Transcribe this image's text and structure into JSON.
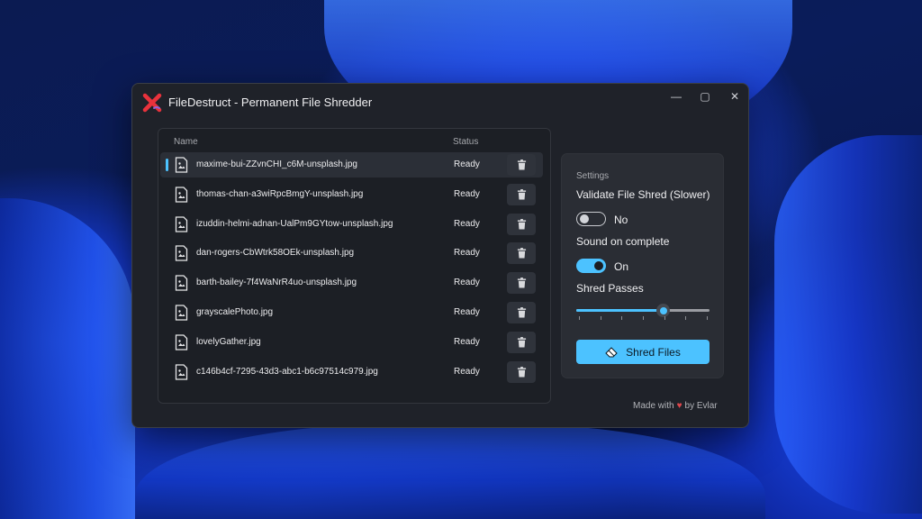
{
  "window": {
    "title": "FileDestruct - Permanent File Shredder",
    "controls": {
      "minimize": "—",
      "maximize": "▢",
      "close": "✕"
    }
  },
  "file_list": {
    "columns": {
      "name": "Name",
      "status": "Status"
    },
    "files": [
      {
        "name": "maxime-bui-ZZvnCHI_c6M-unsplash.jpg",
        "status": "Ready",
        "selected": true
      },
      {
        "name": "thomas-chan-a3wiRpcBmgY-unsplash.jpg",
        "status": "Ready"
      },
      {
        "name": "izuddin-helmi-adnan-UalPm9GYtow-unsplash.jpg",
        "status": "Ready"
      },
      {
        "name": "dan-rogers-CbWtrk58OEk-unsplash.jpg",
        "status": "Ready"
      },
      {
        "name": "barth-bailey-7f4WaNrR4uo-unsplash.jpg",
        "status": "Ready"
      },
      {
        "name": "grayscalePhoto.jpg",
        "status": "Ready"
      },
      {
        "name": "lovelyGather.jpg",
        "status": "Ready"
      },
      {
        "name": "c146b4cf-7295-43d3-abc1-b6c97514c979.jpg",
        "status": "Ready"
      }
    ]
  },
  "settings": {
    "title": "Settings",
    "validate": {
      "label": "Validate File Shred (Slower)",
      "state": "No",
      "on": false
    },
    "sound": {
      "label": "Sound on complete",
      "state": "On",
      "on": true
    },
    "passes": {
      "label": "Shred Passes",
      "level": 0.65,
      "ticks": 7
    },
    "shred_button": "Shred Files"
  },
  "footer": {
    "prefix": "Made with",
    "heart": "♥",
    "suffix": "by Evlar"
  },
  "colors": {
    "accent": "#4cc2ff",
    "heart": "#e0474c",
    "brand_x": "#e8323c"
  },
  "icons": {
    "app": "red-x-shredder-icon",
    "file": "image-file-icon",
    "delete": "trash-icon",
    "shred": "eraser-icon"
  }
}
